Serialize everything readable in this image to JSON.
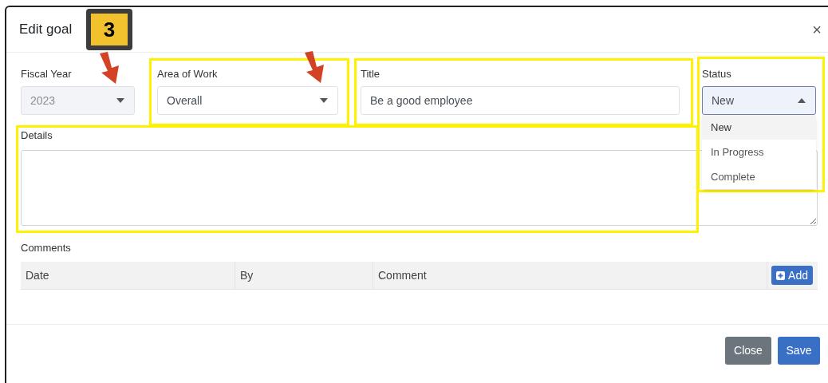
{
  "modal": {
    "title": "Edit goal",
    "close": "×"
  },
  "badge": "3",
  "fields": [
    {
      "kind": "select",
      "label": "Fiscal Year",
      "value": "2023",
      "disabled": true,
      "expanded": false
    },
    {
      "kind": "select",
      "label": "Area of Work",
      "value": "Overall",
      "disabled": false,
      "expanded": false
    },
    {
      "kind": "text",
      "label": "Title",
      "value": "Be a good employee",
      "disabled": false
    },
    {
      "kind": "select",
      "label": "Status",
      "value": "New",
      "disabled": false,
      "expanded": true,
      "options": [
        {
          "label": "New",
          "selected": true
        },
        {
          "label": "In Progress",
          "selected": false
        },
        {
          "label": "Complete",
          "selected": false
        }
      ]
    }
  ],
  "details": {
    "label": "Details"
  },
  "comments": {
    "label": "Comments",
    "columns": [
      "Date",
      "By",
      "Comment"
    ],
    "add_button": "Add"
  },
  "footer_buttons": [
    {
      "label": "Close",
      "kind": "secondary"
    },
    {
      "label": "Save",
      "kind": "primary"
    }
  ]
}
